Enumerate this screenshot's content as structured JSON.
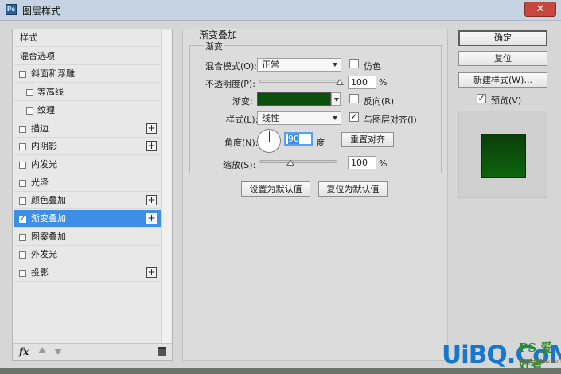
{
  "window": {
    "title": "图层样式",
    "close_glyph": "✕"
  },
  "styles_list": [
    {
      "label": "样式",
      "kind": "plain",
      "checked": false,
      "plus": false
    },
    {
      "label": "混合选项",
      "kind": "plain",
      "checked": false,
      "plus": false
    },
    {
      "label": "斜面和浮雕",
      "kind": "check",
      "checked": false,
      "plus": false
    },
    {
      "label": "等高线",
      "kind": "sub",
      "checked": false,
      "plus": false
    },
    {
      "label": "纹理",
      "kind": "sub",
      "checked": false,
      "plus": false
    },
    {
      "label": "描边",
      "kind": "check",
      "checked": false,
      "plus": true
    },
    {
      "label": "内阴影",
      "kind": "check",
      "checked": false,
      "plus": true
    },
    {
      "label": "内发光",
      "kind": "check",
      "checked": false,
      "plus": false
    },
    {
      "label": "光泽",
      "kind": "check",
      "checked": false,
      "plus": false
    },
    {
      "label": "颜色叠加",
      "kind": "check",
      "checked": false,
      "plus": true
    },
    {
      "label": "渐变叠加",
      "kind": "check",
      "checked": true,
      "plus": true,
      "selected": true
    },
    {
      "label": "图案叠加",
      "kind": "check",
      "checked": false,
      "plus": false
    },
    {
      "label": "外发光",
      "kind": "check",
      "checked": false,
      "plus": false
    },
    {
      "label": "投影",
      "kind": "check",
      "checked": false,
      "plus": true
    }
  ],
  "footer": {
    "fx_label": "fx"
  },
  "panel": {
    "group_title": "渐变叠加",
    "section_title": "渐变",
    "blend_mode_label": "混合模式(O):",
    "blend_mode_value": "正常",
    "dither_label": "仿色",
    "dither_checked": false,
    "opacity_label": "不透明度(P):",
    "opacity_value": "100",
    "opacity_fraction": 1.0,
    "percent": "%",
    "gradient_label": "渐变:",
    "gradient_color": "#0d4f0d",
    "reverse_label": "反向(R)",
    "reverse_checked": false,
    "style_label": "样式(L):",
    "style_value": "线性",
    "align_label": "与图层对齐(I)",
    "align_checked": true,
    "angle_label": "角度(N):",
    "angle_value": "90",
    "angle_unit": "度",
    "reset_align_label": "重置对齐",
    "scale_label": "缩放(S):",
    "scale_value": "100",
    "scale_fraction": 0.4,
    "make_default_label": "设置为默认值",
    "reset_default_label": "复位为默认值"
  },
  "right": {
    "ok_label": "确定",
    "reset_label": "复位",
    "new_style_label": "新建样式(W)...",
    "preview_label": "预览(V)",
    "preview_checked": true,
    "preview_color": "#0d5a0d"
  },
  "watermark": {
    "brand": "UiBQ.CoM",
    "ps_mark": "PS 爱好者",
    "domain": "www.psahz.com"
  }
}
